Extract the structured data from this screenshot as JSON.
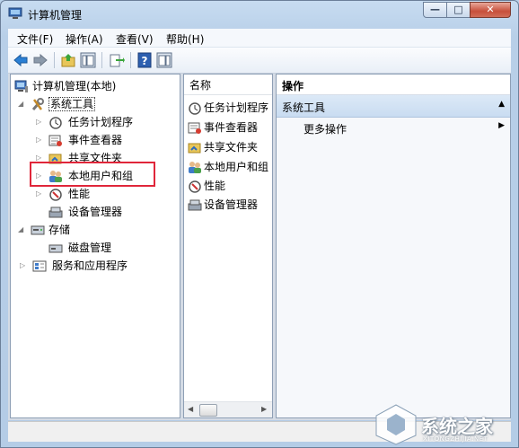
{
  "window": {
    "title": "计算机管理"
  },
  "caption_buttons": {
    "minimize": "—",
    "maximize": "□",
    "close": "✕"
  },
  "menu": [
    "文件(F)",
    "操作(A)",
    "查看(V)",
    "帮助(H)"
  ],
  "toolbar": [
    "back-arrow-icon",
    "forward-arrow-icon",
    "up-folder-icon",
    "show-hide-tree-icon",
    "export-list-icon",
    "help-icon",
    "show-hide-action-pane-icon"
  ],
  "tree": {
    "root": "计算机管理(本地)",
    "system_tools": "系统工具",
    "task_scheduler": "任务计划程序",
    "event_viewer": "事件查看器",
    "shared_folders": "共享文件夹",
    "local_users": "本地用户和组",
    "performance": "性能",
    "device_manager": "设备管理器",
    "storage": "存储",
    "disk_management": "磁盘管理",
    "services_apps": "服务和应用程序"
  },
  "list": {
    "column_header": "名称",
    "items": [
      "任务计划程序",
      "事件查看器",
      "共享文件夹",
      "本地用户和组",
      "性能",
      "设备管理器"
    ]
  },
  "actions": {
    "header": "操作",
    "section": "系统工具",
    "item": "更多操作"
  },
  "watermark": {
    "text": "系统之家",
    "sub": "XITONGZHIJIA.NET"
  }
}
